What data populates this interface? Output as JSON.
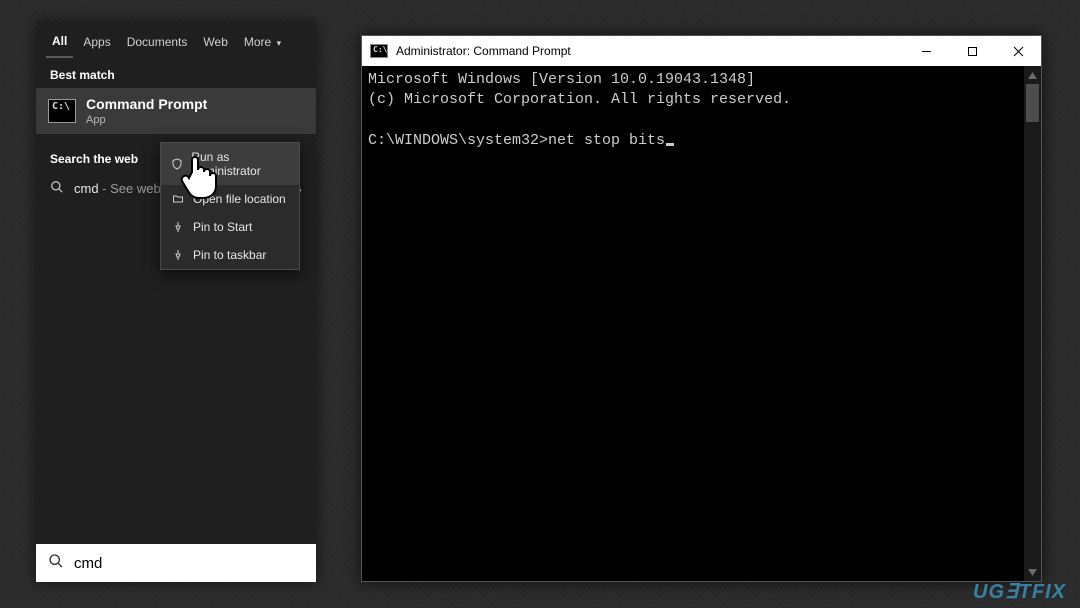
{
  "search": {
    "tabs": {
      "all": "All",
      "apps": "Apps",
      "documents": "Documents",
      "web": "Web",
      "more": "More"
    },
    "best_match_label": "Best match",
    "best_match": {
      "title": "Command Prompt",
      "subtitle": "App"
    },
    "search_web_label": "Search the web",
    "web_item": {
      "prefix": "cmd",
      "suffix": " - See web results"
    },
    "ctx": {
      "run_as_admin": "Run as administrator",
      "open_file_location": "Open file location",
      "pin_to_start": "Pin to Start",
      "pin_to_taskbar": "Pin to taskbar"
    },
    "input_value": "cmd"
  },
  "cmd": {
    "title": "Administrator: Command Prompt",
    "line1": "Microsoft Windows [Version 10.0.19043.1348]",
    "line2": "(c) Microsoft Corporation. All rights reserved.",
    "prompt": "C:\\WINDOWS\\system32>",
    "typed": "net stop bits"
  },
  "watermark": "UGETFIX"
}
